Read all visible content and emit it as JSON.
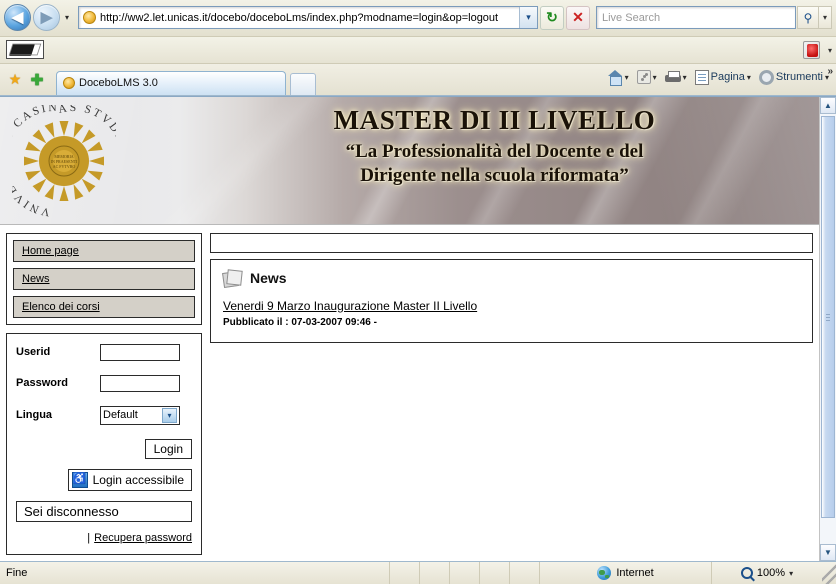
{
  "browser": {
    "url": "http://ww2.let.unicas.it/docebo/doceboLms/index.php?modname=login&op=logout",
    "search_placeholder": "Live Search",
    "search_value": "",
    "back_glyph": "◀",
    "forward_glyph": "▶",
    "refresh_glyph": "↻",
    "stop_glyph": "✕",
    "caret_glyph": "▾",
    "search_go_glyph": "⚲",
    "tab": {
      "title": "DoceboLMS 3.0"
    },
    "commands": [
      {
        "icon": "home-icon",
        "label": "",
        "has_caret": true
      },
      {
        "icon": "rss-feed-icon",
        "label": "",
        "has_caret": true
      },
      {
        "icon": "print-icon",
        "label": "",
        "has_caret": true
      },
      {
        "icon": "page-icon",
        "label": "Pagina",
        "has_caret": true
      },
      {
        "icon": "gear-icon",
        "label": "Strumenti",
        "has_caret": true
      }
    ],
    "overflow_glyph": "»"
  },
  "banner": {
    "title": "MASTER  DI II LIVELLO",
    "subtitle_line1": "“La Professionalità del Docente e del",
    "subtitle_line2": "Dirigente nella scuola riformata”",
    "seal_text_outer": "VNIVERSITAS CASINAS STVDIORVM",
    "seal_color": "#c59a28"
  },
  "sidebar": {
    "menu": [
      {
        "label": "Home page"
      },
      {
        "label": "News"
      },
      {
        "label": "Elenco dei corsi"
      }
    ],
    "login": {
      "userid_label": "Userid",
      "userid_value": "",
      "password_label": "Password",
      "password_value": "",
      "lingua_label": "Lingua",
      "lingua_value": "Default",
      "lingua_options": [
        "Default"
      ],
      "login_button": "Login",
      "accessible_button": "Login accessibile",
      "status_message": "Sei disconnesso",
      "recover_separator": "|",
      "recover_link": "Recupera password"
    }
  },
  "main": {
    "news_panel": {
      "heading": "News",
      "items": [
        {
          "title": "Venerdi 9 Marzo Inaugurazione Master II Livello",
          "meta": "Pubblicato il : 07-03-2007 09:46 -"
        }
      ]
    }
  },
  "statusbar": {
    "text": "Fine",
    "zone": "Internet",
    "zoom": "100%",
    "zoom_caret": "▾"
  }
}
